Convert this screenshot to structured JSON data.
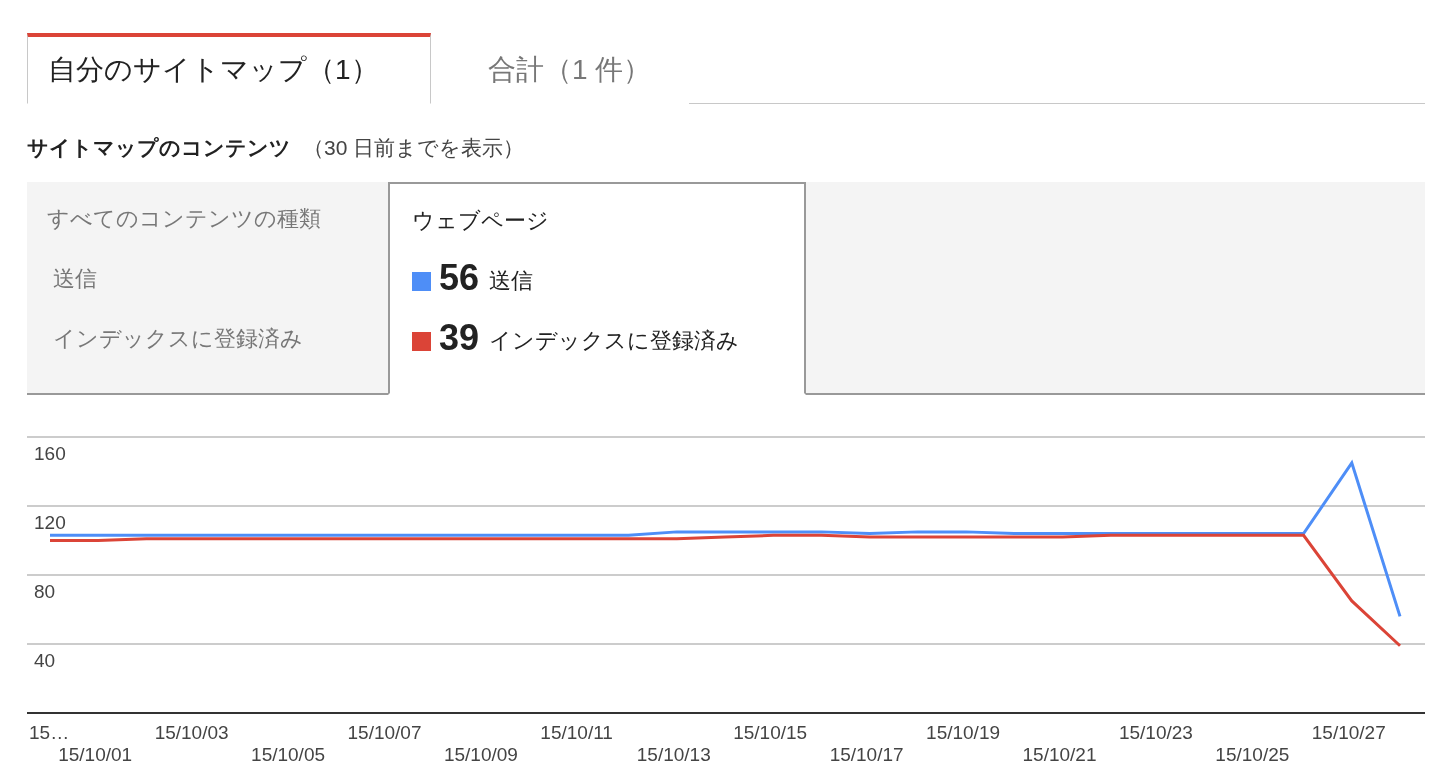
{
  "tabs": [
    {
      "label": "自分のサイトマップ（1）",
      "selected": true
    },
    {
      "label": "合計（1 件）",
      "selected": false
    }
  ],
  "section": {
    "title": "サイトマップのコンテンツ",
    "note": "（30 日前までを表示）"
  },
  "content_types": [
    {
      "label": "すべてのコンテンツの種類",
      "selected": false,
      "metrics": [
        {
          "label": "送信"
        },
        {
          "label": "インデックスに登録済み"
        }
      ]
    },
    {
      "label": "ウェブページ",
      "selected": true,
      "metrics": [
        {
          "value": "56",
          "label": "送信",
          "color": "#4e8ef7"
        },
        {
          "value": "39",
          "label": "インデックスに登録済み",
          "color": "#db4437"
        }
      ]
    }
  ],
  "chart_data": {
    "type": "line",
    "categories": [
      "15…",
      "15/10/01",
      null,
      "15/10/03",
      null,
      "15/10/05",
      null,
      "15/10/07",
      null,
      "15/10/09",
      null,
      "15/10/11",
      null,
      "15/10/13",
      null,
      "15/10/15",
      null,
      "15/10/17",
      null,
      "15/10/19",
      null,
      "15/10/21",
      null,
      "15/10/23",
      null,
      "15/10/25",
      null,
      "15/10/27",
      null
    ],
    "ylim": [
      0,
      160
    ],
    "grid": true,
    "yticks": [
      40,
      80,
      120,
      160
    ],
    "series": [
      {
        "color": "#4e8ef7",
        "values": [
          103,
          103,
          103,
          103,
          103,
          103,
          103,
          103,
          103,
          103,
          103,
          103,
          103,
          105,
          105,
          105,
          105,
          104,
          105,
          105,
          104,
          104,
          104,
          104,
          104,
          104,
          104,
          145,
          56
        ]
      },
      {
        "color": "#db4437",
        "values": [
          100,
          100,
          101,
          101,
          101,
          101,
          101,
          101,
          101,
          101,
          101,
          101,
          101,
          101,
          102,
          103,
          103,
          102,
          102,
          102,
          102,
          102,
          103,
          103,
          103,
          103,
          103,
          65,
          39
        ]
      }
    ]
  }
}
